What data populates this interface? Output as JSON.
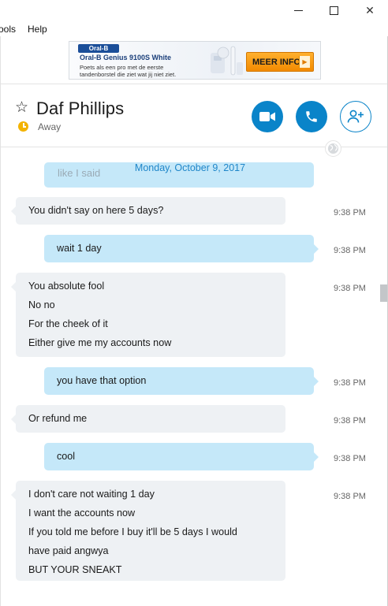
{
  "window": {
    "minimize_icon": "minimize-icon",
    "maximize_icon": "maximize-icon",
    "close_icon": "close-icon",
    "close_glyph": "✕"
  },
  "menu": {
    "tools": "ools",
    "help": "Help"
  },
  "ad": {
    "brand": "Oral-B",
    "title": "Oral-B Genius 9100S White",
    "line1": "Poets als een pro met de eerste",
    "line2": "tandenborstel die ziet wat jij niet ziet.",
    "cta": "MEER INFO",
    "cta_arrow": "▶",
    "cta_color": "#f59d10"
  },
  "contact": {
    "star_glyph": "☆",
    "name": "Daf Phillips",
    "status": "Away",
    "status_color": "#f3b300"
  },
  "header_buttons": {
    "video_icon": "video-call-icon",
    "call_icon": "phone-icon",
    "add_icon": "add-contact-icon",
    "accent": "#0a84c9"
  },
  "chat": {
    "partial_message": "like I said",
    "date": "Monday, October 9, 2017",
    "messages": [
      {
        "dir": "in",
        "lines": [
          "You didn't say on here 5 days?"
        ],
        "time": "9:38 PM"
      },
      {
        "dir": "out",
        "lines": [
          "wait 1 day"
        ],
        "time": "9:38 PM"
      },
      {
        "dir": "in",
        "lines": [
          "You absolute fool",
          "No no",
          "For the cheek of it",
          "Either give me my accounts now"
        ],
        "time": "9:38 PM"
      },
      {
        "dir": "out",
        "lines": [
          "you have that option"
        ],
        "time": "9:38 PM"
      },
      {
        "dir": "in",
        "lines": [
          "Or refund me"
        ],
        "time": "9:38 PM"
      },
      {
        "dir": "out",
        "lines": [
          "cool"
        ],
        "time": "9:38 PM"
      },
      {
        "dir": "in",
        "lines": [
          "I don't care not waiting 1 day",
          "I want the accounts now",
          "If you told me before I buy it'll be 5 days I would",
          "have paid angwya",
          "BUT YOUR SNEAKT"
        ],
        "time": "9:38 PM"
      }
    ]
  }
}
